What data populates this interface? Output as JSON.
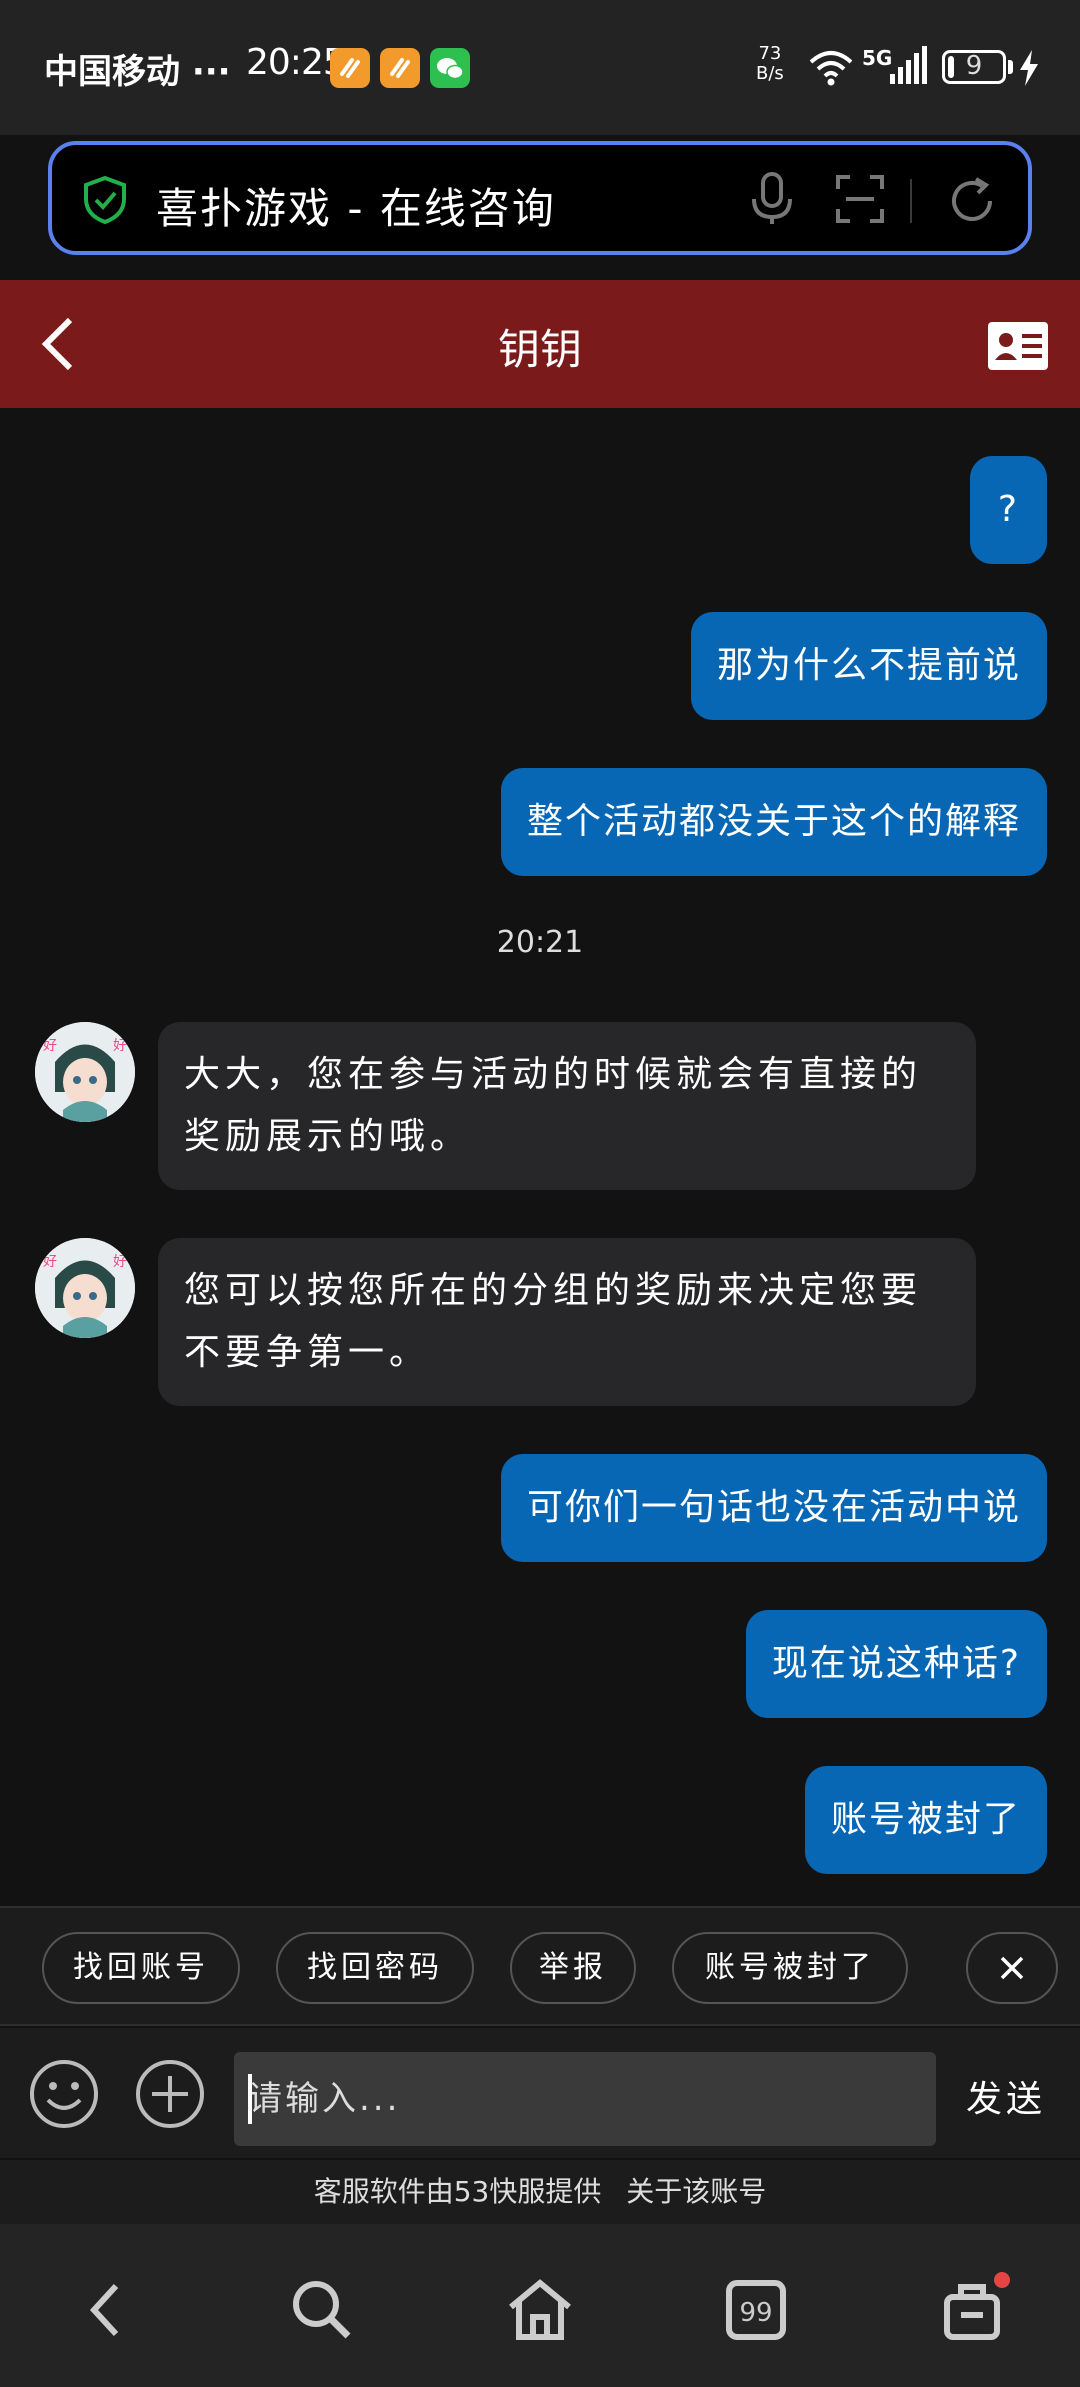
{
  "status_bar": {
    "carrier": "中国移动 ···",
    "time": "20:25",
    "net_speed_value": "73",
    "net_speed_unit": "B/s",
    "network": "5G",
    "battery": "9"
  },
  "browser": {
    "page_title": "喜扑游戏 - 在线咨询"
  },
  "chat": {
    "agent_name": "钥钥",
    "timestamp": "20:21",
    "messages": [
      {
        "dir": "out",
        "text": "?"
      },
      {
        "dir": "out",
        "text": "那为什么不提前说"
      },
      {
        "dir": "out",
        "text": "整个活动都没关于这个的解释"
      },
      {
        "dir": "in",
        "text": "大大，您在参与活动的时候就会有直接的奖励展示的哦。"
      },
      {
        "dir": "in",
        "text": "您可以按您所在的分组的奖励来决定您要不要争第一。"
      },
      {
        "dir": "out",
        "text": "可你们一句话也没在活动中说"
      },
      {
        "dir": "out",
        "text": "现在说这种话?"
      },
      {
        "dir": "out",
        "text": "账号被封了"
      }
    ]
  },
  "quick_replies": [
    "找回账号",
    "找回密码",
    "举报",
    "账号被封了"
  ],
  "input": {
    "placeholder": "请输入...",
    "send_label": "发送"
  },
  "footer": {
    "provider_text": "客服软件由53快服提供",
    "about_link": "关于该账号"
  },
  "colors": {
    "header_bg": "#7b1a1a",
    "outgoing_bubble": "#0867b4",
    "incoming_bubble": "#272729",
    "address_border": "#5b80f0"
  }
}
